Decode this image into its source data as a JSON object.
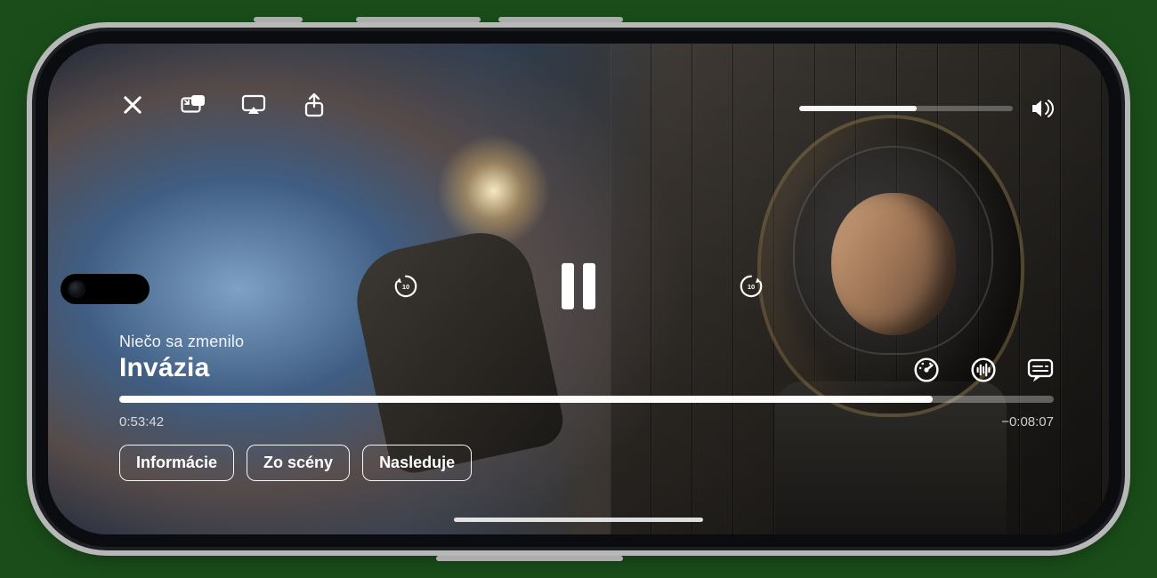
{
  "player": {
    "episode_subtitle": "Niečo sa zmenilo",
    "show_title": "Invázia",
    "elapsed": "0:53:42",
    "remaining": "−0:08:07",
    "progress_pct": 87,
    "volume_pct": 55,
    "skip_seconds": "10",
    "tabs": {
      "info": "Informácie",
      "scenes": "Zo scény",
      "upnext": "Nasleduje"
    }
  }
}
